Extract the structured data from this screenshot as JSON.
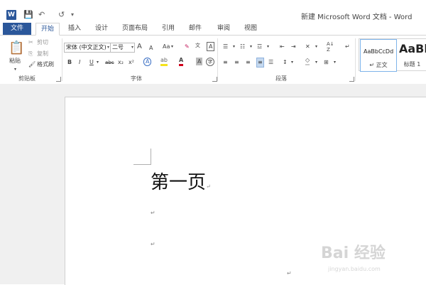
{
  "window": {
    "title": "新建 Microsoft Word 文档 - Word",
    "app_icon": "W"
  },
  "quick_access": {
    "save_icon": "💾",
    "undo_icon": "↶",
    "redo_icon": "↺",
    "customize_icon": "▾"
  },
  "tabs": {
    "file": "文件",
    "items": [
      "开始",
      "插入",
      "设计",
      "页面布局",
      "引用",
      "邮件",
      "审阅",
      "视图"
    ],
    "active": "开始"
  },
  "clipboard": {
    "paste": "粘贴",
    "cut": "剪切",
    "copy": "复制",
    "format_painter": "格式刷",
    "label": "剪贴板"
  },
  "font": {
    "font_name": "宋体 (中文正文)",
    "font_size": "二号",
    "grow": "A",
    "shrink": "A",
    "case": "Aa",
    "bold": "B",
    "italic": "I",
    "underline": "U",
    "strike": "abc",
    "subscript": "x₂",
    "superscript": "x²",
    "label": "字体"
  },
  "paragraph": {
    "label": "段落"
  },
  "styles": {
    "normal_sample": "AaBbCcDd",
    "normal_name": "正文",
    "heading_sample": "AaBl",
    "heading_name": "标题 1"
  },
  "document": {
    "heading": "第一页",
    "para_mark": "↵"
  },
  "watermark": {
    "text": "Bai 经验",
    "url": "jingyan.baidu.com"
  }
}
